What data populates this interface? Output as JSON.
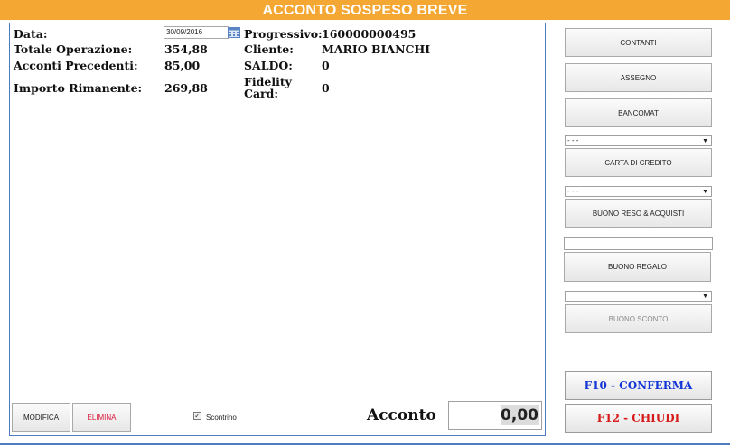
{
  "title": "ACCONTO SOSPESO BREVE",
  "info": {
    "data_label": "Data:",
    "data_value": "30/09/2016",
    "totale_label": "Totale Operazione:",
    "totale_value": "354,88",
    "acconti_label": "Acconti Precedenti:",
    "acconti_value": "85,00",
    "importo_label": "Importo Rimanente:",
    "importo_value": "269,88",
    "progressivo_label": "Progressivo:",
    "progressivo_value": "160000000495",
    "cliente_label": "Cliente:",
    "cliente_value": "MARIO BIANCHI",
    "saldo_label": "SALDO:",
    "saldo_value": "0",
    "fidelity_label_line1": "Fidelity",
    "fidelity_label_line2": "Card:",
    "fidelity_value": "0"
  },
  "buttons": {
    "modifica": "MODIFICA",
    "elimina": "ELIMINA",
    "contanti": "CONTANTI",
    "assegno": "ASSEGNO",
    "bancomat": "BANCOMAT",
    "carta_credito": "CARTA  DI CREDITO",
    "buono_reso": "BUONO RESO & ACQUISTI",
    "buono_regalo": "BUONO REGALO",
    "buono_sconto": "BUONO SCONTO",
    "conferma": "F10 - CONFERMA",
    "chiudi": "F12 - CHIUDI"
  },
  "selects": {
    "carta_credito_value": "- - -",
    "buono_reso_value": "- - -",
    "buono_sconto_value": ""
  },
  "scontrino": {
    "label": "Scontrino",
    "checked": true
  },
  "acconto": {
    "label": "Acconto",
    "value": "0,00"
  },
  "colors": {
    "title_bar": "#f5a733",
    "panel_border": "#4d7cc2",
    "confirm_text": "#1436d6",
    "close_text": "#d71a1a",
    "delete_text": "#d8163a"
  }
}
